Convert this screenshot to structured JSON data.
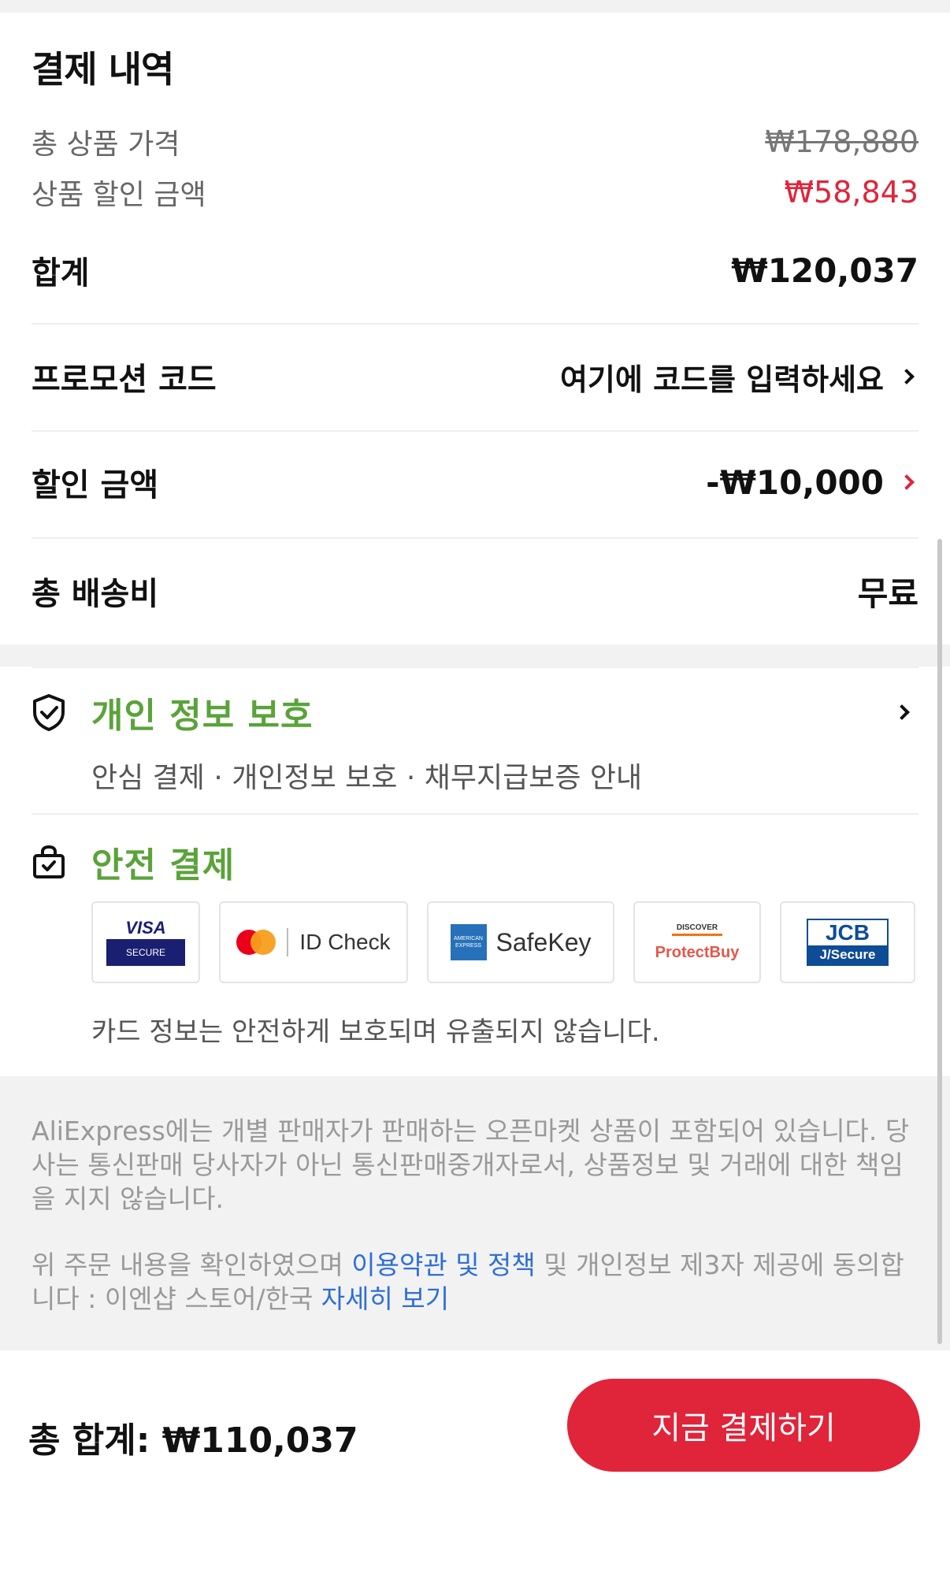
{
  "summary": {
    "title": "결제 내역",
    "product_total_label": "총 상품 가격",
    "product_total_value": "₩178,880",
    "product_discount_label": "상품 할인 금액",
    "product_discount_value": "₩58,843",
    "subtotal_label": "합계",
    "subtotal_value": "₩120,037",
    "promo_label": "프로모션 코드",
    "promo_value": "여기에 코드를 입력하세요",
    "discount_label": "할인 금액",
    "discount_value": "-₩10,000",
    "shipping_label": "총 배송비",
    "shipping_value": "무료"
  },
  "privacy": {
    "title": "개인 정보 보호",
    "subtitle": "안심 결제 · 개인정보 보호 · 채무지급보증 안내"
  },
  "secure_payment": {
    "title": "안전 결제",
    "cards": {
      "visa_top": "VISA",
      "visa_bottom": "SECURE",
      "mastercard": "ID Check",
      "amex_box": "AMERICAN EXPRESS",
      "amex": "SafeKey",
      "discover_top": "DISCOVER",
      "discover": "ProtectBuy",
      "jcb_top": "JCB",
      "jcb_bottom": "J/Secure"
    },
    "note": "카드 정보는 안전하게 보호되며 유출되지 않습니다."
  },
  "disclaimer": {
    "paragraph1": "AliExpress에는 개별 판매자가 판매하는 오픈마켓 상품이 포함되어 있습니다. 당사는 통신판매 당사자가 아닌 통신판매중개자로서, 상품정보 및 거래에 대한 책임을 지지 않습니다.",
    "p2_before": "위 주문 내용을 확인하였으며 ",
    "p2_link1": "이용약관 및 정책",
    "p2_middle": " 및 개인정보 제3자 제공에 동의합니다 : 이엔샵 스토어/한국 ",
    "p2_link2": "자세히 보기"
  },
  "footer": {
    "total_label": "총 합계:",
    "total_value": "₩110,037",
    "pay_button": "지금 결제하기"
  },
  "colors": {
    "accent_red": "#e0243a",
    "trust_green": "#5aa33a",
    "link_blue": "#2f6fd6"
  }
}
